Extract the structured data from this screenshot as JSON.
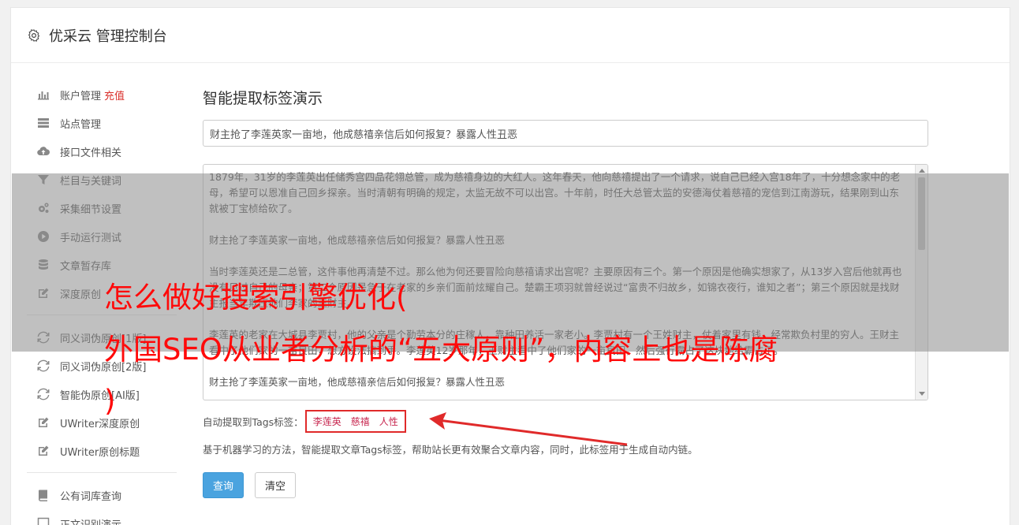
{
  "header": {
    "title": "优采云 管理控制台",
    "icon": "gear-icon"
  },
  "sidebar": {
    "group1": [
      {
        "label": "账户管理",
        "badge": "充值",
        "icon": "bar-chart-icon"
      },
      {
        "label": "站点管理",
        "icon": "server-icon"
      },
      {
        "label": "接口文件相关",
        "icon": "cloud-upload-icon"
      },
      {
        "label": "栏目与关键词",
        "icon": "filter-icon"
      },
      {
        "label": "采集细节设置",
        "icon": "cogs-icon"
      },
      {
        "label": "手动运行测试",
        "icon": "play-icon"
      },
      {
        "label": "文章暂存库",
        "icon": "database-icon"
      },
      {
        "label": "深度原创",
        "icon": "edit-icon"
      }
    ],
    "group2": [
      {
        "label": "同义词伪原创[1版]",
        "icon": "refresh-icon"
      },
      {
        "label": "同义词伪原创[2版]",
        "icon": "refresh-icon"
      },
      {
        "label": "智能伪原创[AI版]",
        "icon": "refresh-icon"
      },
      {
        "label": "UWriter深度原创",
        "icon": "edit-icon"
      },
      {
        "label": "UWriter原创标题",
        "icon": "edit-icon"
      }
    ],
    "group3": [
      {
        "label": "公有词库查询",
        "icon": "book-icon"
      },
      {
        "label": "正文识别演示",
        "icon": "square-icon"
      }
    ]
  },
  "main": {
    "heading": "智能提取标签演示",
    "title_value": "财主抢了李莲英家一亩地，他成慈禧亲信后如何报复？暴露人性丑恶",
    "paragraphs": [
      "1879年，31岁的李莲英出任储秀宫四品花翎总管，成为慈禧身边的大红人。这年春天，他向慈禧提出了一个请求，说自己已经入宫18年了，十分想念家中的老母，希望可以恩准自己回乡探亲。当时清朝有明确的规定，太监无故不可以出宫。十年前，时任大总管太监的安德海仗着慈禧的宠信到江南游玩，结果刚到山东就被丁宝桢给砍了。",
      "财主抢了李莲英家一亩地，他成慈禧亲信后如何报复？暴露人性丑恶",
      "当时李莲英还是二总管，这件事他再清楚不过。那么他为何还要冒险向慈禧请求出宫呢？主要原因有三个。第一个原因是他确实想家了，从13岁入宫后他就再也没有见过自己的母亲；第二个原因是急于在老家的乡亲们面前炫耀自己。楚霸王项羽就曾经说过“富贵不归故乡，如锦衣夜行，谁知之者”；第三个原因就是找财主报当年欺压他们李家的王财主。",
      "李莲英的老家在大城县李贾村，他的父亲是个勤劳本分的庄稼人，靠种田养活一家老小。李贾村有一个王姓财主，仗着家里有钱，经常欺负村里的穷人。王财主看中了他们家的一亩良田，想方设法搞到手。李莲英12岁那年，王财主看中了他们家的一亩良田，然后强行霸占了这块地给霸占了。",
      "财主抢了李莲英家一亩地，他成慈禧亲信后如何报复？暴露人性丑恶"
    ],
    "tags_label": "自动提取到Tags标签：",
    "tags": [
      "李莲英",
      "慈禧",
      "人性"
    ],
    "help_text": "基于机器学习的方法，智能提取文章Tags标签，帮助站长更有效聚合文章内容，同时，此标签用于生成自动内链。",
    "query_button": "查询",
    "clear_button": "清空"
  },
  "overlay": {
    "line1": "怎么做好搜索引擎优化(",
    "line2": "外国SEO从业者分析的“五大原则”，内容上也是陈腐",
    "line3": ")"
  }
}
